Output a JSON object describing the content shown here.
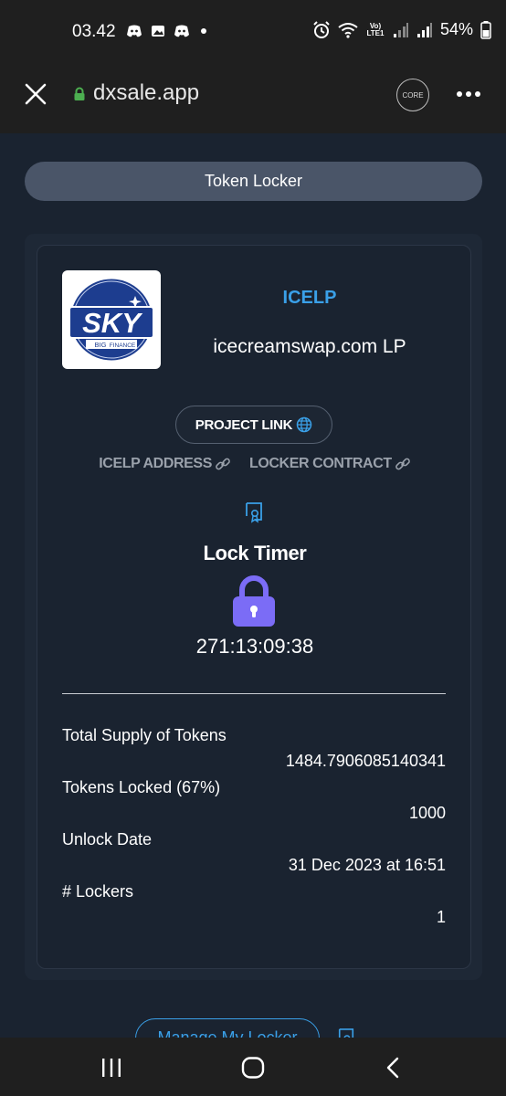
{
  "status_bar": {
    "time": "03.42",
    "battery": "54%",
    "network_label": "Vo) LTE1"
  },
  "browser": {
    "url": "dxsale.app",
    "core_badge": "CORE"
  },
  "page": {
    "section_title": "Token Locker",
    "logo": {
      "brand": "SKY",
      "tagline_left": "BIG",
      "tagline_right": "FINANCE"
    },
    "token_symbol": "ICELP",
    "token_name": "icecreamswap.com LP",
    "project_link_label": "PROJECT LINK",
    "address_link_label": "ICELP ADDRESS",
    "contract_link_label": "LOCKER CONTRACT",
    "lock_timer_title": "Lock Timer",
    "countdown": "271:13:09:38",
    "info": [
      {
        "label": "Total Supply of Tokens",
        "value": "1484.7906085140341"
      },
      {
        "label": "Tokens Locked (67%)",
        "value": "1000"
      },
      {
        "label": "Unlock Date",
        "value": "31 Dec 2023 at 16:51"
      },
      {
        "label": "# Lockers",
        "value": "1"
      }
    ],
    "manage_button_label": "Manage My Locker"
  },
  "colors": {
    "accent": "#3aa0e8",
    "lock_purple": "#7b6cf6",
    "background": "#1a2330"
  }
}
